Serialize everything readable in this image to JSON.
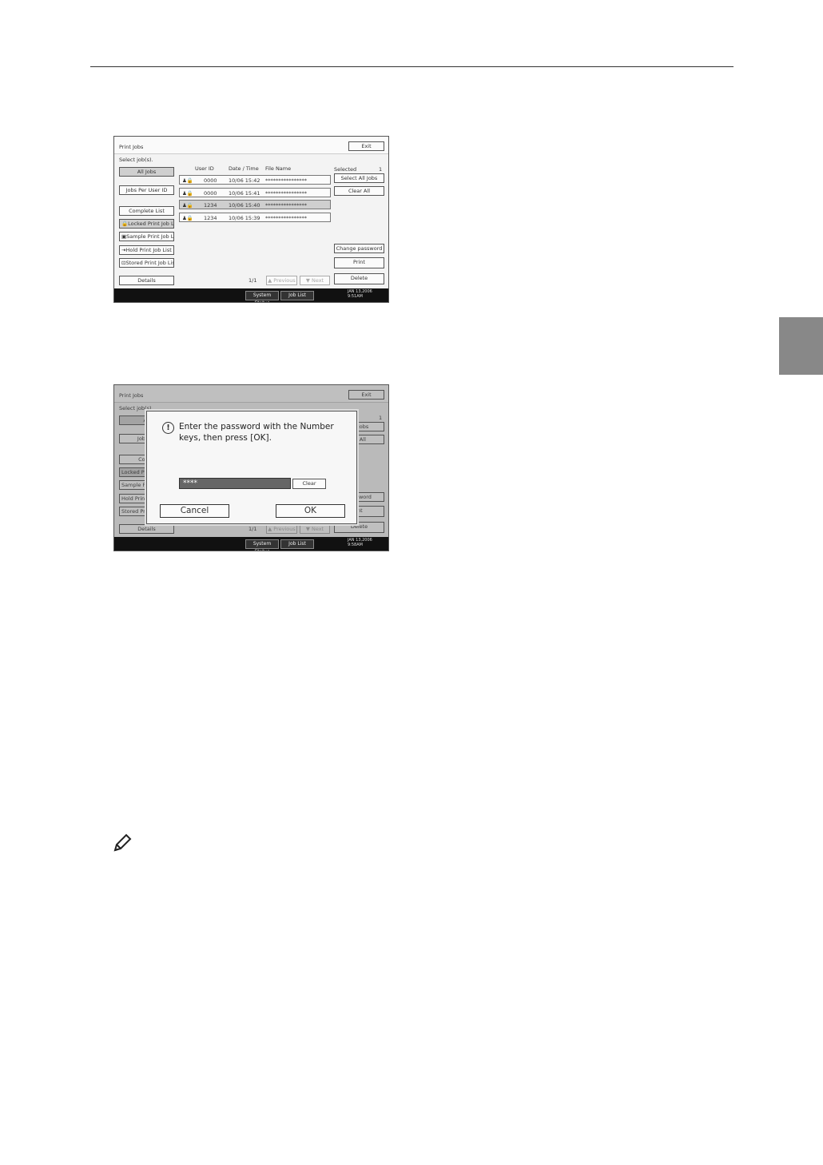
{
  "screen1": {
    "title": "Print Jobs",
    "exit_label": "Exit",
    "select_prompt": "Select job(s).",
    "left_buttons": [
      "All Jobs",
      "Jobs Per User ID"
    ],
    "list_buttons": [
      "Complete List",
      "Locked Print Job List",
      "Sample Print Job List",
      "Hold Print Job List",
      "Stored Print Job List"
    ],
    "details_label": "Details",
    "columns": [
      "User ID",
      "Date / Time",
      "File Name"
    ],
    "rows": [
      {
        "user_id": "0000",
        "datetime": "10/06 15:42",
        "file_name": "****************"
      },
      {
        "user_id": "0000",
        "datetime": "10/06 15:41",
        "file_name": "****************"
      },
      {
        "user_id": "1234",
        "datetime": "10/06 15:40",
        "file_name": "****************"
      },
      {
        "user_id": "1234",
        "datetime": "10/06 15:39",
        "file_name": "****************"
      }
    ],
    "selected_label": "Selected",
    "selected_count": "1",
    "right_buttons": [
      "Select All Jobs",
      "Clear All",
      "Change password",
      "Print",
      "Delete"
    ],
    "page": "1/1",
    "prev_label": "▲ Previous",
    "next_label": "▼ Next",
    "footer_buttons": [
      "System Status",
      "Job List"
    ],
    "footer_date": "JAN 13,2006",
    "footer_time": "9:51AM"
  },
  "screen2": {
    "title": "Print Jobs",
    "exit_label": "Exit",
    "select_prompt": "Select job(s).",
    "visible_left_fragments": [
      "All",
      "Jobs Pe",
      "Compl",
      "Locked Pr",
      "Sample Pr",
      "Hold Prin",
      "Stored Pr"
    ],
    "details_label": "Details",
    "selected_count": "1",
    "right_fragments": [
      "All Jobs",
      "ar All",
      "password",
      "int",
      "Delete"
    ],
    "page": "1/1",
    "prev_label": "▲ Previous",
    "next_label": "▼ Next",
    "dialog": {
      "message": "Enter the password with the Number keys, then press [OK].",
      "password_value": "****",
      "clear_label": "Clear",
      "cancel_label": "Cancel",
      "ok_label": "OK"
    },
    "footer_buttons": [
      "System Status",
      "Job List"
    ],
    "footer_date": "JAN 13,2006",
    "footer_time": "9:58AM"
  }
}
